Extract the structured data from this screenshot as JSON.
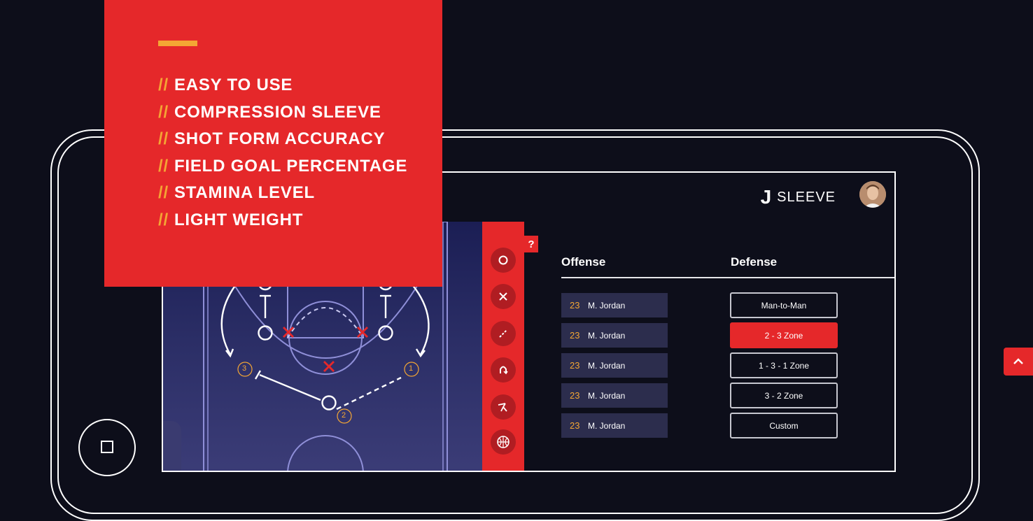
{
  "features": {
    "prefix": "//",
    "items": [
      "EASY TO USE",
      "COMPRESSION SLEEVE",
      "SHOT FORM ACCURACY",
      "FIELD GOAL PERCENTAGE",
      "STAMINA LEVEL",
      "LIGHT WEIGHT"
    ]
  },
  "app": {
    "brand_mark": "J",
    "brand_name": "SLEEVE",
    "help_label": "?",
    "offense_header": "Offense",
    "defense_header": "Defense",
    "offense_rows": [
      {
        "number": "23",
        "name": "M. Jordan"
      },
      {
        "number": "23",
        "name": "M. Jordan"
      },
      {
        "number": "23",
        "name": "M. Jordan"
      },
      {
        "number": "23",
        "name": "M. Jordan"
      },
      {
        "number": "23",
        "name": "M. Jordan"
      }
    ],
    "defense_options": [
      "Man-to-Man",
      "2 - 3 Zone",
      "1 - 3 - 1 Zone",
      "3 - 2 Zone",
      "Custom"
    ],
    "selected_defense": "2 - 3 Zone",
    "court_markers": [
      "3",
      "1",
      "2"
    ],
    "tools": [
      "circle-icon",
      "cross-icon",
      "dashed-line-icon",
      "curve-arrow-icon",
      "screen-icon",
      "basketball-icon"
    ]
  },
  "colors": {
    "accent_red": "#e5282a",
    "accent_orange": "#f4a634",
    "background": "#0d0e1a"
  }
}
